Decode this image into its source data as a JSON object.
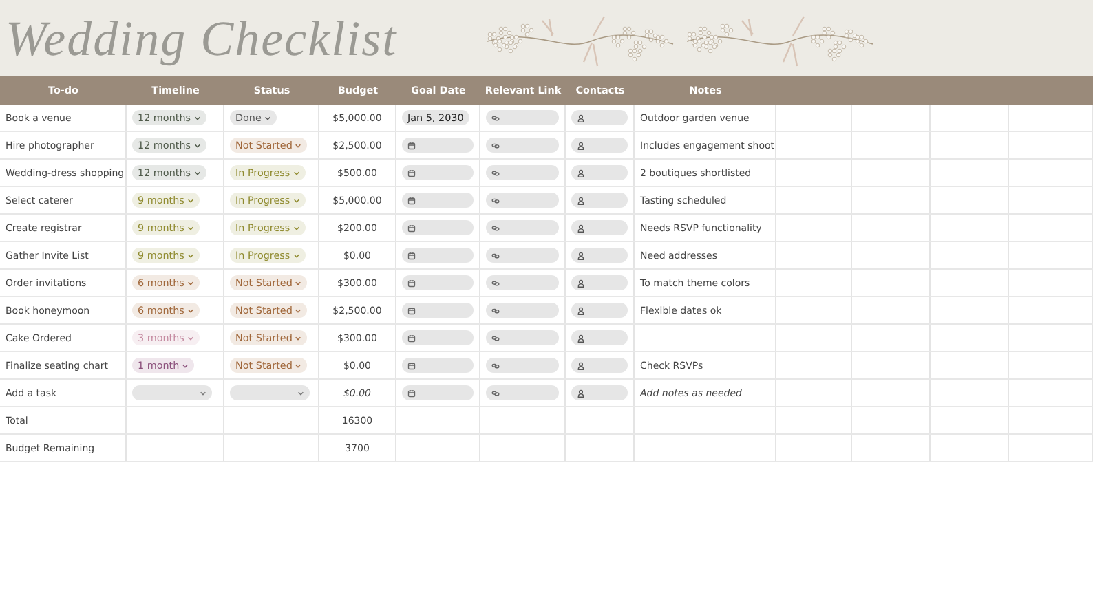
{
  "title": "Wedding Checklist",
  "columns": [
    "To-do",
    "Timeline",
    "Status",
    "Budget",
    "Goal Date",
    "Relevant Link",
    "Contacts",
    "Notes"
  ],
  "rows": [
    {
      "kind": "task",
      "task": "Book a venue",
      "timeline": {
        "label": "12 months",
        "color": "#4f5a4a"
      },
      "status": {
        "label": "Done",
        "color": "#555555"
      },
      "budget": "$5,000.00",
      "goal_date": "Jan 5, 2030",
      "notes": "Outdoor garden venue"
    },
    {
      "kind": "task",
      "task": "Hire photographer",
      "timeline": {
        "label": "12 months",
        "color": "#4f5a4a"
      },
      "status": {
        "label": "Not Started",
        "color": "#a0673a"
      },
      "budget": "$2,500.00",
      "notes": "Includes engagement shoot"
    },
    {
      "kind": "task",
      "task": "Wedding-dress shopping",
      "timeline": {
        "label": "12 months",
        "color": "#4f5a4a"
      },
      "status": {
        "label": "In Progress",
        "color": "#8f8a2e"
      },
      "budget": "$500.00",
      "notes": "2 boutiques shortlisted"
    },
    {
      "kind": "task",
      "task": "Select caterer",
      "timeline": {
        "label": "9 months",
        "color": "#8f8a2e"
      },
      "status": {
        "label": "In Progress",
        "color": "#8f8a2e"
      },
      "budget": "$5,000.00",
      "notes": "Tasting scheduled"
    },
    {
      "kind": "task",
      "task": "Create registrar",
      "timeline": {
        "label": "9 months",
        "color": "#8f8a2e"
      },
      "status": {
        "label": "In Progress",
        "color": "#8f8a2e"
      },
      "budget": "$200.00",
      "notes": "Needs RSVP functionality"
    },
    {
      "kind": "task",
      "task": "Gather Invite List",
      "timeline": {
        "label": "9 months",
        "color": "#8f8a2e"
      },
      "status": {
        "label": "In Progress",
        "color": "#8f8a2e"
      },
      "budget": "$0.00",
      "notes": "Need addresses"
    },
    {
      "kind": "task",
      "task": "Order invitations",
      "timeline": {
        "label": "6 months",
        "color": "#a0673a"
      },
      "status": {
        "label": "Not Started",
        "color": "#a0673a"
      },
      "budget": "$300.00",
      "notes": "To match theme colors"
    },
    {
      "kind": "task",
      "task": "Book honeymoon",
      "timeline": {
        "label": "6 months",
        "color": "#a0673a"
      },
      "status": {
        "label": "Not Started",
        "color": "#a0673a"
      },
      "budget": "$2,500.00",
      "notes": "Flexible dates ok"
    },
    {
      "kind": "task",
      "task": "Cake Ordered",
      "timeline": {
        "label": "3 months",
        "color": "#c48aa0"
      },
      "status": {
        "label": "Not Started",
        "color": "#a0673a"
      },
      "budget": "$300.00"
    },
    {
      "kind": "task",
      "task": "Finalize seating chart",
      "timeline": {
        "label": "1 month",
        "color": "#8a4f7a"
      },
      "status": {
        "label": "Not Started",
        "color": "#a0673a"
      },
      "budget": "$0.00",
      "notes": "Check RSVPs"
    },
    {
      "kind": "placeholder",
      "task": "Add a task",
      "budget": "$0.00",
      "notes": "Add notes as needed"
    },
    {
      "kind": "summary",
      "task": "Total",
      "budget": "16300"
    },
    {
      "kind": "summary",
      "task": "Budget Remaining",
      "budget": "3700"
    }
  ]
}
